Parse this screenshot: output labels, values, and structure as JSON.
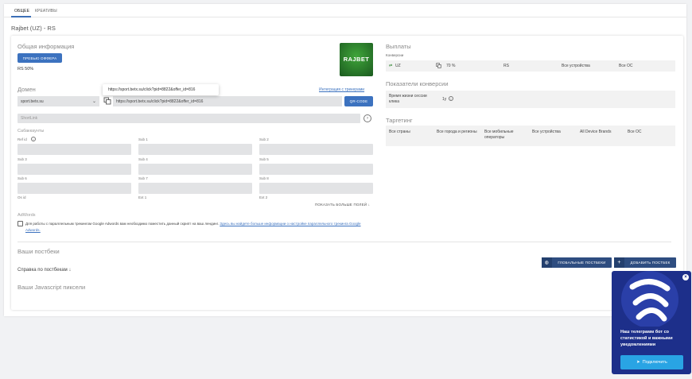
{
  "tabs": [
    {
      "label": "ОБЩЕЕ"
    },
    {
      "label": "КРЕАТИВЫ"
    }
  ],
  "page_title": "Rajbet (UZ) - RS",
  "general": {
    "heading": "Общая информация",
    "preview_button": "ПРЕВЬЮ ОФФЕРА",
    "rs_text": "RS 50%",
    "logo_text": "RAJBET"
  },
  "domain": {
    "heading": "Домен",
    "select_value": "sport.betx.su",
    "tooltip_url": "https://sport.betx.su/click?pid=8822&offer_id=816",
    "url_value": "https://sport.betx.su/click?pid=8822&offer_id=816",
    "integration_link": "Интеграция с трекерами",
    "qr_button": "QR-CODE",
    "shortlink_placeholder": "ShortLink"
  },
  "subaccounts": {
    "heading": "Сабаккаунты",
    "labels": [
      "Ref id",
      "Sub 1",
      "Sub 2",
      "Sub 3",
      "Sub 4",
      "Sub 5",
      "Sub 6",
      "Sub 7",
      "Sub 8",
      "Os id",
      "Ext 1",
      "Ext 2"
    ],
    "show_more": "ПОКАЗАТЬ БОЛЬШЕ ПОЛЕЙ"
  },
  "adwords": {
    "heading": "AdWords",
    "text": "Для работы с параллельным трекингом Google Adwords вам необходимо поместить данный скрипт на ваш лендинг.",
    "link": "Здесь вы найдете больше информации о настройке параллельного трекинга Google Adwords."
  },
  "postbacks": {
    "heading": "Ваши постбеки",
    "help": "Справка по постбекам",
    "global_button": "ГЛОБАЛЬНЫЕ ПОСТБЕКИ",
    "add_button": "ДОБАВИТЬ ПОСТБЕК",
    "js_heading": "Ваши Javascript пиксели"
  },
  "payouts": {
    "heading": "Выплаты",
    "sub": "Конверсии",
    "row": {
      "country": "UZ",
      "rate": "70 %",
      "type": "RS",
      "devices": "Все устройства",
      "os": "Все ОС"
    }
  },
  "conversion": {
    "heading": "Показатели конверсии",
    "label": "Время жизни сессии клика",
    "value": "1y"
  },
  "targeting": {
    "heading": "Таргетинг",
    "columns": [
      "Все страны",
      "Все города и регионы",
      "Все мобильные операторы",
      "Все устройства",
      "All Device Brands",
      "Все ОС"
    ]
  },
  "popup": {
    "text": "Наш телеграмм бот со статистикой и важными уведомлениями",
    "button": "Подключить"
  },
  "colors": {
    "accent": "#3c72bf",
    "popup_bg": "#1d2f8a",
    "popup_button": "#29a4e4"
  }
}
